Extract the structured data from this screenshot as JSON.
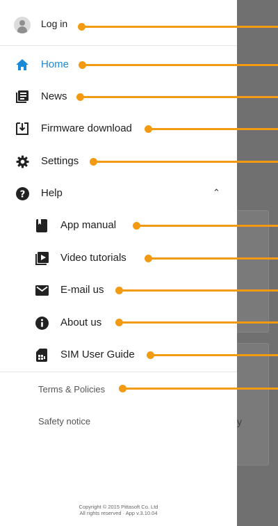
{
  "login": {
    "label": "Log in",
    "icon": "account-icon"
  },
  "menu": [
    {
      "key": "home",
      "label": "Home",
      "icon": "home-icon",
      "active": true
    },
    {
      "key": "news",
      "label": "News",
      "icon": "news-icon"
    },
    {
      "key": "firmware",
      "label": "Firmware download",
      "icon": "download-box-icon"
    },
    {
      "key": "settings",
      "label": "Settings",
      "icon": "gear-icon"
    },
    {
      "key": "help",
      "label": "Help",
      "icon": "help-circle-icon",
      "expanded": true
    }
  ],
  "help_items": [
    {
      "key": "manual",
      "label": "App manual",
      "icon": "book-icon"
    },
    {
      "key": "video",
      "label": "Video tutorials",
      "icon": "video-library-icon"
    },
    {
      "key": "email",
      "label": "E-mail us",
      "icon": "envelope-icon"
    },
    {
      "key": "about",
      "label": "About us",
      "icon": "info-icon"
    },
    {
      "key": "sim",
      "label": "SIM User Guide",
      "icon": "sim-card-icon"
    }
  ],
  "footer": {
    "terms": "Terms & Policies",
    "safety": "Safety notice",
    "copyright_line1": "Copyright © 2015 Pittasoft Co. Ltd",
    "copyright_line2": "All rights reserved · App v.3.10.04"
  },
  "background": {
    "visible_text": "y"
  },
  "colors": {
    "accent": "#1a8ad8",
    "callout": "#f29a12",
    "scrim": "#707070"
  }
}
